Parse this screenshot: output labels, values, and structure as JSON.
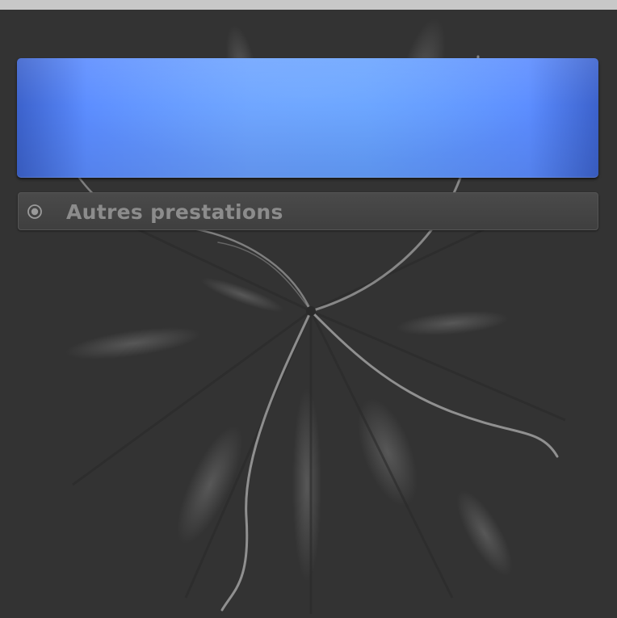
{
  "colors": {
    "background": "#333333",
    "top_bar": "#c8c8c8",
    "hero_blue": "#5b8cff",
    "menu_text": "#8c8c8c"
  },
  "hero_panel": {
    "text": ""
  },
  "menu": {
    "items": [
      {
        "label": "Autres prestations",
        "icon": "radio-icon"
      }
    ]
  }
}
